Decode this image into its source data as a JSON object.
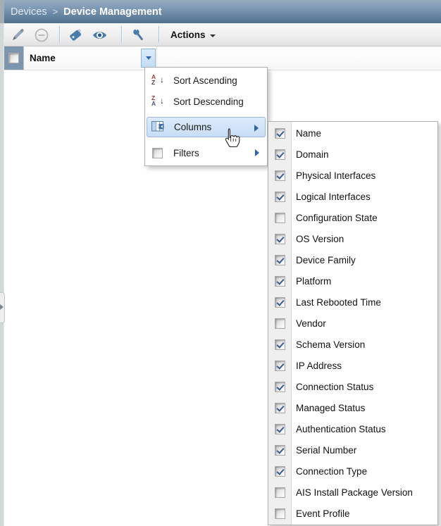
{
  "breadcrumb": {
    "parent": "Devices",
    "separator": ">",
    "current": "Device Management"
  },
  "toolbar": {
    "buttons": [
      {
        "icon": "pencil-icon",
        "action": "edit",
        "disabled": true
      },
      {
        "icon": "minus-circle-icon",
        "action": "delete",
        "disabled": true
      },
      {
        "icon": "tag-icon",
        "action": "tag"
      },
      {
        "icon": "eye-icon",
        "action": "view"
      },
      {
        "icon": "wrench-icon",
        "action": "key-management"
      }
    ],
    "actions_label": "Actions"
  },
  "grid": {
    "first_column_header": "Name"
  },
  "header_menu": {
    "items": [
      {
        "label": "Sort Ascending",
        "icon": "sort-asc",
        "submenu": false,
        "active": false,
        "separator_after": false
      },
      {
        "label": "Sort Descending",
        "icon": "sort-desc",
        "submenu": false,
        "active": false,
        "separator_after": true
      },
      {
        "label": "Columns",
        "icon": "columns",
        "submenu": true,
        "active": true,
        "separator_after": true
      },
      {
        "label": "Filters",
        "icon": "filters",
        "submenu": true,
        "active": false,
        "separator_after": false
      }
    ]
  },
  "columns_submenu": {
    "items": [
      {
        "label": "Name",
        "checked": true
      },
      {
        "label": "Domain",
        "checked": true
      },
      {
        "label": "Physical Interfaces",
        "checked": true
      },
      {
        "label": "Logical Interfaces",
        "checked": true
      },
      {
        "label": "Configuration State",
        "checked": false
      },
      {
        "label": "OS Version",
        "checked": true
      },
      {
        "label": "Device Family",
        "checked": true
      },
      {
        "label": "Platform",
        "checked": true
      },
      {
        "label": "Last Rebooted Time",
        "checked": true
      },
      {
        "label": "Vendor",
        "checked": false
      },
      {
        "label": "Schema Version",
        "checked": true
      },
      {
        "label": "IP Address",
        "checked": true
      },
      {
        "label": "Connection Status",
        "checked": true
      },
      {
        "label": "Managed Status",
        "checked": true
      },
      {
        "label": "Authentication Status",
        "checked": true
      },
      {
        "label": "Serial Number",
        "checked": true
      },
      {
        "label": "Connection Type",
        "checked": true
      },
      {
        "label": "AIS Install Package Version",
        "checked": false
      },
      {
        "label": "Event Profile",
        "checked": false
      }
    ]
  },
  "colors": {
    "header_gradient_top": "#95abc0",
    "header_gradient_bottom": "#52708c",
    "accent_blue": "#4a7cab",
    "menu_highlight_bg": "#d2e3f8",
    "menu_highlight_border": "#9ab7e4",
    "check_mark": "#3a5c91",
    "select_cell_bg": "#7e96ad"
  }
}
